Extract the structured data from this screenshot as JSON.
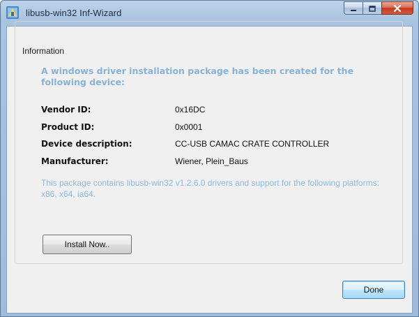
{
  "window": {
    "title": "libusb-win32 Inf-Wizard",
    "icon": "wizard-app-icon",
    "caption_buttons": [
      "minimize-icon",
      "maximize-icon",
      "close-icon"
    ]
  },
  "information": {
    "group_title": "Information",
    "headline": "A windows driver installation package has been created for the following device:",
    "fields": [
      {
        "label": "Vendor ID:",
        "value": "0x16DC"
      },
      {
        "label": "Product ID:",
        "value": "0x0001"
      },
      {
        "label": "Device description:",
        "value": "CC-USB CAMAC CRATE CONTROLLER"
      },
      {
        "label": "Manufacturer:",
        "value": "Wiener, Plein_Baus"
      }
    ],
    "note": "This package contains libusb-win32 v1.2.6.0 drivers and support for the following platforms: x86, x64, ia64."
  },
  "buttons": {
    "install": "Install Now..",
    "done": "Done"
  },
  "colors": {
    "accent_text": "#86b2d6",
    "note_text": "#8eb8da",
    "close_button": "#c13a22",
    "titlebar": "#bcd3ea"
  }
}
